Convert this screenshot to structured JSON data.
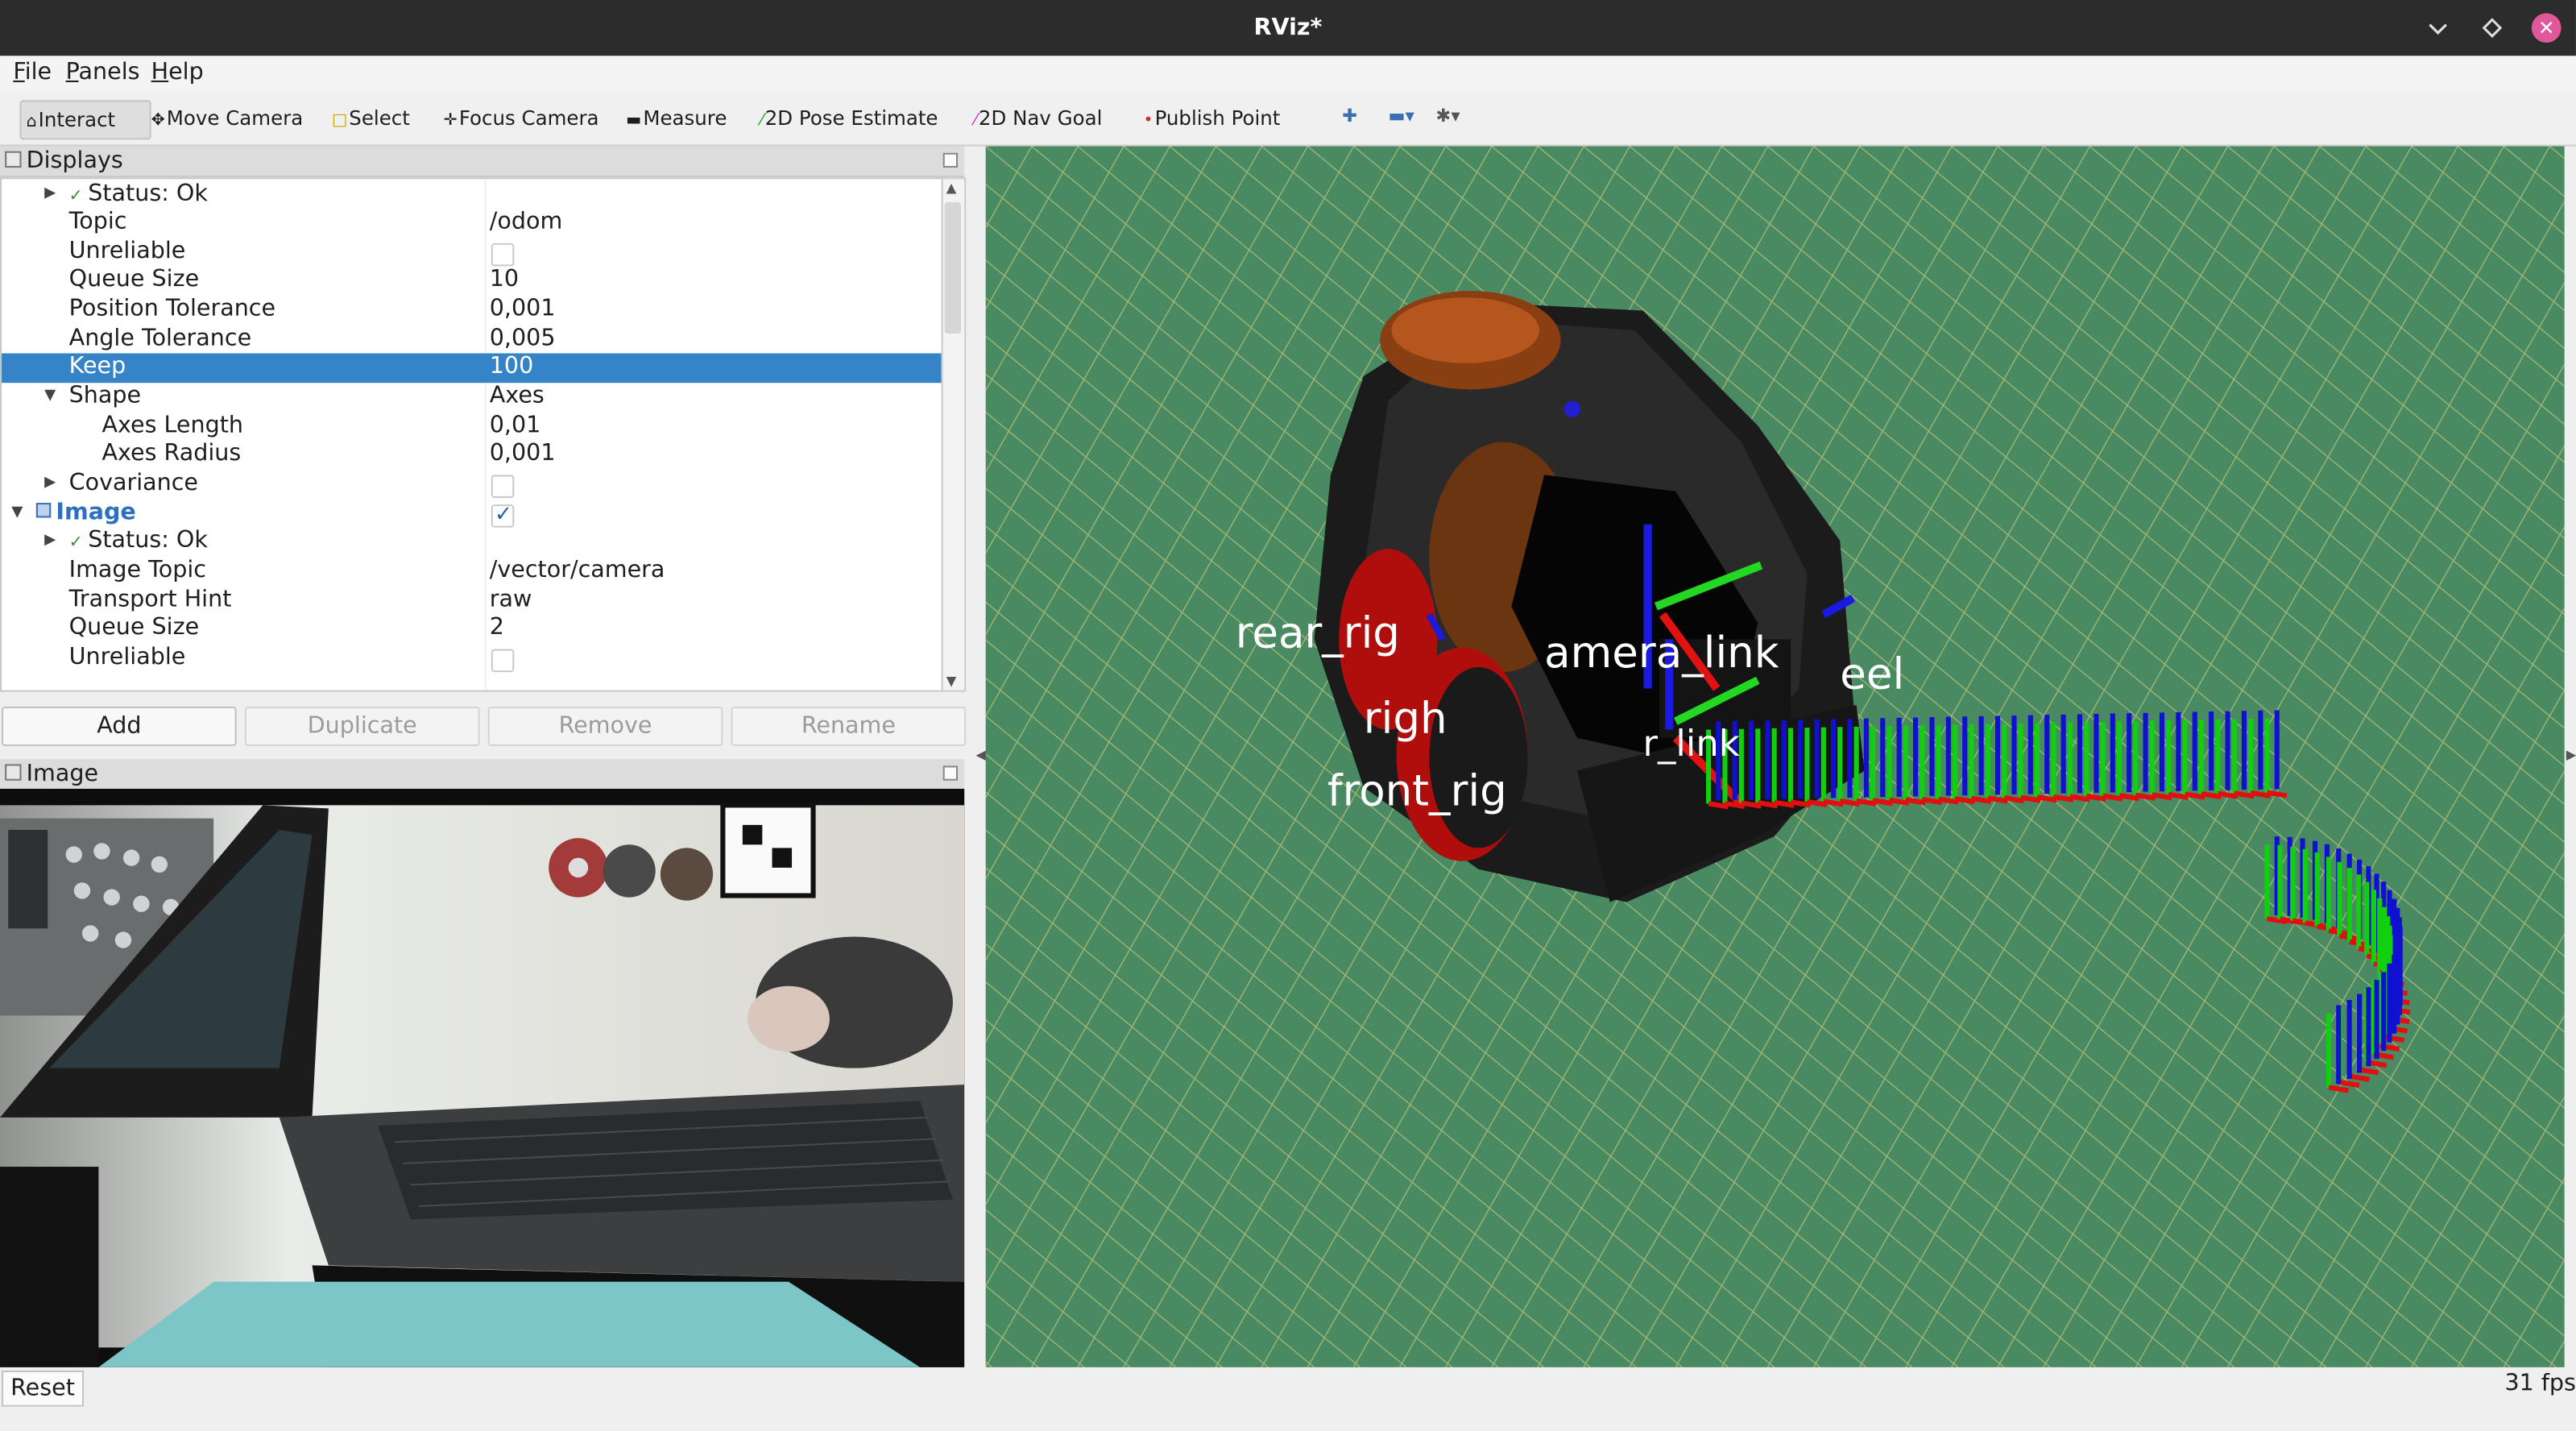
{
  "window": {
    "title": "RViz*"
  },
  "menu": [
    {
      "label": "File",
      "mnemonic": "F",
      "rest": "ile"
    },
    {
      "label": "Panels",
      "mnemonic": "P",
      "rest": "anels"
    },
    {
      "label": "Help",
      "mnemonic": "H",
      "rest": "elp"
    }
  ],
  "toolbar": {
    "tools": [
      {
        "label": "Interact",
        "icon": "interact-icon",
        "active": true
      },
      {
        "label": "Move Camera",
        "icon": "move-camera-icon"
      },
      {
        "label": "Select",
        "icon": "select-icon"
      },
      {
        "label": "Focus Camera",
        "icon": "focus-camera-icon"
      },
      {
        "label": "Measure",
        "icon": "measure-icon"
      },
      {
        "label": "2D Pose Estimate",
        "icon": "pose-estimate-icon",
        "color": "#22aa22"
      },
      {
        "label": "2D Nav Goal",
        "icon": "nav-goal-icon",
        "color": "#cc33cc"
      },
      {
        "label": "Publish Point",
        "icon": "publish-point-icon",
        "color": "#d03030"
      }
    ]
  },
  "displays": {
    "title": "Displays",
    "rows": [
      {
        "label": "Status: Ok",
        "indent": 2,
        "arrow": "collapsed",
        "ok": true
      },
      {
        "label": "Topic",
        "value": "/odom",
        "indent": 1
      },
      {
        "label": "Unreliable",
        "checkbox": false,
        "indent": 1
      },
      {
        "label": "Queue Size",
        "value": "10",
        "indent": 1
      },
      {
        "label": "Position Tolerance",
        "value": "0,001",
        "indent": 1
      },
      {
        "label": "Angle Tolerance",
        "value": "0,005",
        "indent": 1
      },
      {
        "label": "Keep",
        "value": "100",
        "indent": 1,
        "selected": true
      },
      {
        "label": "Shape",
        "value": "Axes",
        "indent": 1,
        "arrow": "expanded"
      },
      {
        "label": "Axes Length",
        "value": "0,01",
        "indent": 2
      },
      {
        "label": "Axes Radius",
        "value": "0,001",
        "indent": 2
      },
      {
        "label": "Covariance",
        "checkbox": false,
        "indent": 1,
        "arrow": "collapsed"
      },
      {
        "label": "Image",
        "checkbox": true,
        "indent": 0,
        "arrow": "expanded",
        "display": true
      },
      {
        "label": "Status: Ok",
        "indent": 2,
        "arrow": "collapsed",
        "ok": true
      },
      {
        "label": "Image Topic",
        "value": "/vector/camera",
        "indent": 1
      },
      {
        "label": "Transport Hint",
        "value": "raw",
        "indent": 1
      },
      {
        "label": "Queue Size",
        "value": "2",
        "indent": 1
      },
      {
        "label": "Unreliable",
        "checkbox": false,
        "indent": 1
      }
    ],
    "buttons": {
      "add": "Add",
      "duplicate": "Duplicate",
      "remove": "Remove",
      "rename": "Rename"
    }
  },
  "image_panel": {
    "title": "Image"
  },
  "viewport": {
    "background": "#4a8a63",
    "grid_color": "#b6c37a",
    "tf_labels": [
      "rear_rig",
      "amera_link",
      "eel",
      "righ",
      "front_rig",
      "r_link"
    ],
    "axis_colors": {
      "x": "#e01010",
      "y": "#10d010",
      "z": "#1010d0"
    }
  },
  "status": {
    "reset": "Reset",
    "fps": "31 fps"
  }
}
